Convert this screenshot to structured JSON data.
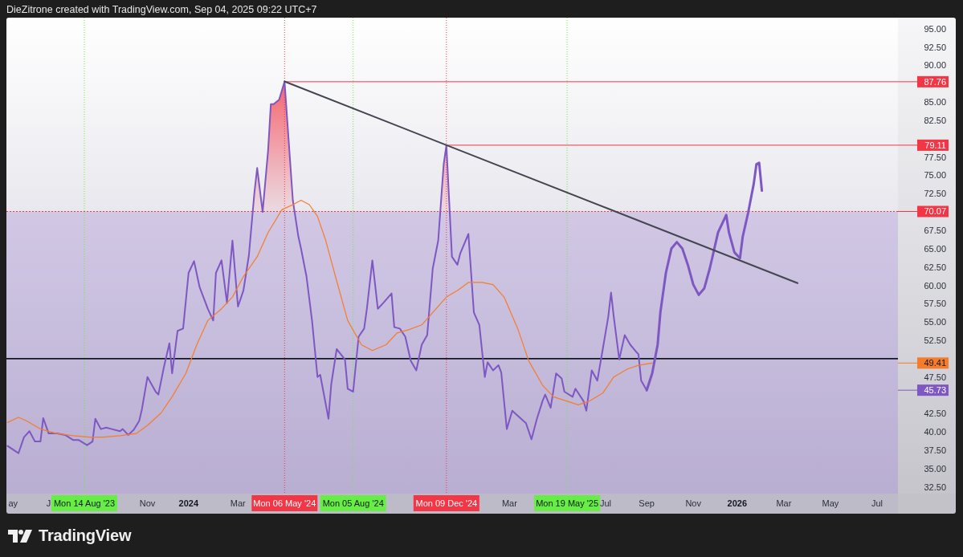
{
  "header": {
    "caption": "DieZitrone created with TradingView.com, Sep 04, 2025 09:22 UTC+7"
  },
  "chart": {
    "chart_data": {
      "type": "line",
      "xlim": [
        2023.336,
        2026.586
      ],
      "ylim": [
        31.6,
        96.5
      ],
      "series": [
        {
          "color": "#7e57c2",
          "x": [
            2023.34,
            2023.38,
            2023.4,
            2023.42,
            2023.44,
            2023.46,
            2023.47,
            2023.49,
            2023.52,
            2023.55,
            2023.58,
            2023.6,
            2023.63,
            2023.65,
            2023.66,
            2023.68,
            2023.7,
            2023.72,
            2023.75,
            2023.76,
            2023.78,
            2023.8,
            2023.82,
            2023.83,
            2023.85,
            2023.88,
            2023.89,
            2023.91,
            2023.93,
            2023.94,
            2023.96,
            2023.98,
            2024.0,
            2024.02,
            2024.04,
            2024.07,
            2024.09,
            2024.1,
            2024.12,
            2024.14,
            2024.16,
            2024.18,
            2024.2,
            2024.22,
            2024.24,
            2024.25,
            2024.27,
            2024.29,
            2024.3,
            2024.31,
            2024.33,
            2024.35,
            2024.38,
            2024.4,
            2024.41,
            2024.43,
            2024.45,
            2024.47,
            2024.48,
            2024.51,
            2024.52,
            2024.54,
            2024.57,
            2024.58,
            2024.6,
            2024.62,
            2024.64,
            2024.65,
            2024.67,
            2024.69,
            2024.71,
            2024.74,
            2024.75,
            2024.77,
            2024.79,
            2024.81,
            2024.83,
            2024.85,
            2024.87,
            2024.89,
            2024.91,
            2024.93,
            2024.94,
            2024.96,
            2024.98,
            2024.99,
            2025.02,
            2025.04,
            2025.06,
            2025.08,
            2025.09,
            2025.11,
            2025.13,
            2025.14,
            2025.16,
            2025.18,
            2025.2,
            2025.23,
            2025.25,
            2025.27,
            2025.29,
            2025.3,
            2025.32,
            2025.34,
            2025.36,
            2025.37,
            2025.4,
            2025.41,
            2025.44,
            2025.45,
            2025.47,
            2025.49,
            2025.51,
            2025.53,
            2025.54,
            2025.55,
            2025.57,
            2025.59,
            2025.61,
            2025.63,
            2025.64,
            2025.65,
            2025.67
          ],
          "values": [
            38.1,
            37.1,
            39.3,
            40.1,
            38.7,
            38.7,
            41.9,
            39.8,
            39.8,
            39.6,
            38.9,
            38.9,
            38.2,
            38.7,
            41.8,
            40.4,
            40.6,
            40.4,
            40.1,
            40.4,
            39.6,
            40.3,
            41.5,
            43.1,
            47.5,
            45.5,
            45.1,
            48.8,
            52.1,
            48.0,
            53.8,
            54.1,
            61.7,
            63.3,
            59.8,
            56.8,
            55.2,
            61.7,
            63.4,
            57.6,
            66.1,
            57.1,
            59.3,
            64.1,
            72.7,
            76.0,
            70.0,
            78.4,
            84.7,
            84.7,
            85.3,
            87.8,
            71.6,
            66.7,
            65.0,
            61.2,
            55.2,
            47.5,
            47.8,
            41.8,
            46.5,
            51.3,
            49.9,
            45.9,
            45.5,
            53.0,
            54.1,
            56.8,
            63.4,
            56.8,
            57.6,
            58.9,
            54.3,
            54.1,
            53.0,
            49.7,
            48.4,
            51.9,
            53.2,
            62.3,
            66.1,
            76.5,
            79.1,
            63.9,
            62.8,
            64.3,
            67.0,
            56.3,
            54.6,
            47.5,
            49.5,
            48.4,
            49.1,
            48.1,
            40.4,
            42.9,
            42.2,
            41.2,
            39.0,
            41.8,
            44.2,
            45.1,
            43.3,
            48.0,
            47.3,
            45.5,
            44.8,
            45.9,
            44.2,
            42.9,
            48.4,
            47.0,
            51.3,
            55.7,
            59.0,
            55.7,
            49.9,
            53.2,
            51.9,
            51.0,
            50.6,
            47.0,
            45.7
          ]
        },
        {
          "color": "#f57c2a",
          "x": [
            2023.34,
            2023.38,
            2023.41,
            2023.46,
            2023.52,
            2023.58,
            2023.64,
            2023.69,
            2023.75,
            2023.81,
            2023.85,
            2023.9,
            2023.94,
            2023.99,
            2024.03,
            2024.07,
            2024.12,
            2024.16,
            2024.2,
            2024.25,
            2024.29,
            2024.34,
            2024.38,
            2024.41,
            2024.44,
            2024.47,
            2024.5,
            2024.54,
            2024.58,
            2024.63,
            2024.67,
            2024.72,
            2024.76,
            2024.8,
            2024.85,
            2024.89,
            2024.94,
            2024.98,
            2025.02,
            2025.07,
            2025.11,
            2025.15,
            2025.2,
            2025.24,
            2025.29,
            2025.33,
            2025.38,
            2025.42,
            2025.46,
            2025.51,
            2025.55,
            2025.6,
            2025.64,
            2025.69
          ],
          "values": [
            41.3,
            42.0,
            41.5,
            40.4,
            39.8,
            39.5,
            39.3,
            39.3,
            39.5,
            39.8,
            40.9,
            42.6,
            44.8,
            48.0,
            51.9,
            55.2,
            56.8,
            58.4,
            61.2,
            63.9,
            67.2,
            70.3,
            71.0,
            71.6,
            71.0,
            69.4,
            66.1,
            60.6,
            55.2,
            51.9,
            51.1,
            51.9,
            53.5,
            53.9,
            54.6,
            56.3,
            58.4,
            59.3,
            60.4,
            60.4,
            60.1,
            58.4,
            54.1,
            49.7,
            46.4,
            44.8,
            44.2,
            43.7,
            44.2,
            45.3,
            47.5,
            48.6,
            49.1,
            49.4
          ]
        },
        {
          "color": "#7e57c2",
          "x": [
            2025.67,
            2025.69,
            2025.71,
            2025.72,
            2025.74,
            2025.76,
            2025.78,
            2025.8,
            2025.82,
            2025.84,
            2025.86,
            2025.88,
            2025.9,
            2025.91,
            2025.93,
            2025.96,
            2025.97,
            2025.99,
            2026.01,
            2026.02,
            2026.04,
            2026.06,
            2026.07,
            2026.08,
            2026.09
          ],
          "values": [
            45.7,
            48.0,
            51.9,
            56.3,
            61.7,
            65.0,
            65.9,
            65.0,
            62.8,
            60.1,
            58.7,
            59.6,
            62.3,
            63.9,
            67.2,
            69.6,
            67.2,
            64.5,
            63.7,
            66.6,
            69.9,
            73.8,
            76.5,
            76.7,
            72.9
          ]
        },
        {
          "color": "#434651",
          "x": [
            2024.35,
            2026.22
          ],
          "values": [
            87.8,
            60.3
          ]
        }
      ],
      "xticks": [
        {
          "value": 2023.36,
          "label": "ay"
        },
        {
          "value": 2023.49,
          "label": "J"
        },
        {
          "value": 2023.85,
          "label": "Nov"
        },
        {
          "value": 2024,
          "label": "2024"
        },
        {
          "value": 2024.18,
          "label": "Mar"
        },
        {
          "value": 2025.17,
          "label": "Mar"
        },
        {
          "value": 2025.52,
          "label": "Jul"
        },
        {
          "value": 2025.67,
          "label": "Sep"
        },
        {
          "value": 2025.84,
          "label": "Nov"
        },
        {
          "value": 2026,
          "label": "2026"
        },
        {
          "value": 2026.17,
          "label": "Mar"
        },
        {
          "value": 2026.34,
          "label": "May"
        },
        {
          "value": 2026.51,
          "label": "Jul"
        }
      ],
      "yticks": [
        {
          "value": 95,
          "label": "95.00"
        },
        {
          "value": 92.5,
          "label": "92.50"
        },
        {
          "value": 90,
          "label": "90.00"
        },
        {
          "value": 85,
          "label": "85.00"
        },
        {
          "value": 82.5,
          "label": "82.50"
        },
        {
          "value": 77.5,
          "label": "77.50"
        },
        {
          "value": 75,
          "label": "75.00"
        },
        {
          "value": 72.5,
          "label": "72.50"
        },
        {
          "value": 67.5,
          "label": "67.50"
        },
        {
          "value": 65,
          "label": "65.00"
        },
        {
          "value": 62.5,
          "label": "62.50"
        },
        {
          "value": 60,
          "label": "60.00"
        },
        {
          "value": 57.5,
          "label": "57.50"
        },
        {
          "value": 55,
          "label": "55.00"
        },
        {
          "value": 52.5,
          "label": "52.50"
        },
        {
          "value": 47.5,
          "label": "47.50"
        },
        {
          "value": 42.5,
          "label": "42.50"
        },
        {
          "value": 40,
          "label": "40.00"
        },
        {
          "value": 37.5,
          "label": "37.50"
        },
        {
          "value": 35,
          "label": "35.00"
        },
        {
          "value": 32.5,
          "label": "32.50"
        }
      ],
      "bands": [
        {
          "axis": "y",
          "from": 30,
          "to": 70.07,
          "color": "#7e57c2"
        }
      ],
      "ref_lines": [
        {
          "axis": "y",
          "value": 87.76,
          "label": "87.76",
          "color": "#f23645"
        },
        {
          "axis": "y",
          "value": 79.11,
          "label": "79.11",
          "color": "#f23645"
        },
        {
          "axis": "y",
          "value": 70.07,
          "label": "70.07",
          "color": "#f23645"
        },
        {
          "axis": "y",
          "value": 50,
          "color": "#131722"
        },
        {
          "axis": "x",
          "value": 2023.62,
          "label": "Mon 14 Aug '23",
          "color": "#66ee44"
        },
        {
          "axis": "x",
          "value": 2024.35,
          "label": "Mon 06 May '24",
          "color": "#f23645"
        },
        {
          "axis": "x",
          "value": 2024.6,
          "label": "Mon 05 Aug '24",
          "color": "#66ee44"
        },
        {
          "axis": "x",
          "value": 2024.94,
          "label": "Mon 09 Dec '24",
          "color": "#f23645"
        },
        {
          "axis": "x",
          "value": 2025.38,
          "label": "Mon 19 May '25",
          "color": "#66ee44"
        }
      ]
    },
    "last_values": [
      {
        "text": "49.41",
        "color": "#f57c2a"
      },
      {
        "text": "45.73",
        "color": "#7e57c2"
      }
    ]
  },
  "footer": {
    "brand": "TradingView"
  }
}
